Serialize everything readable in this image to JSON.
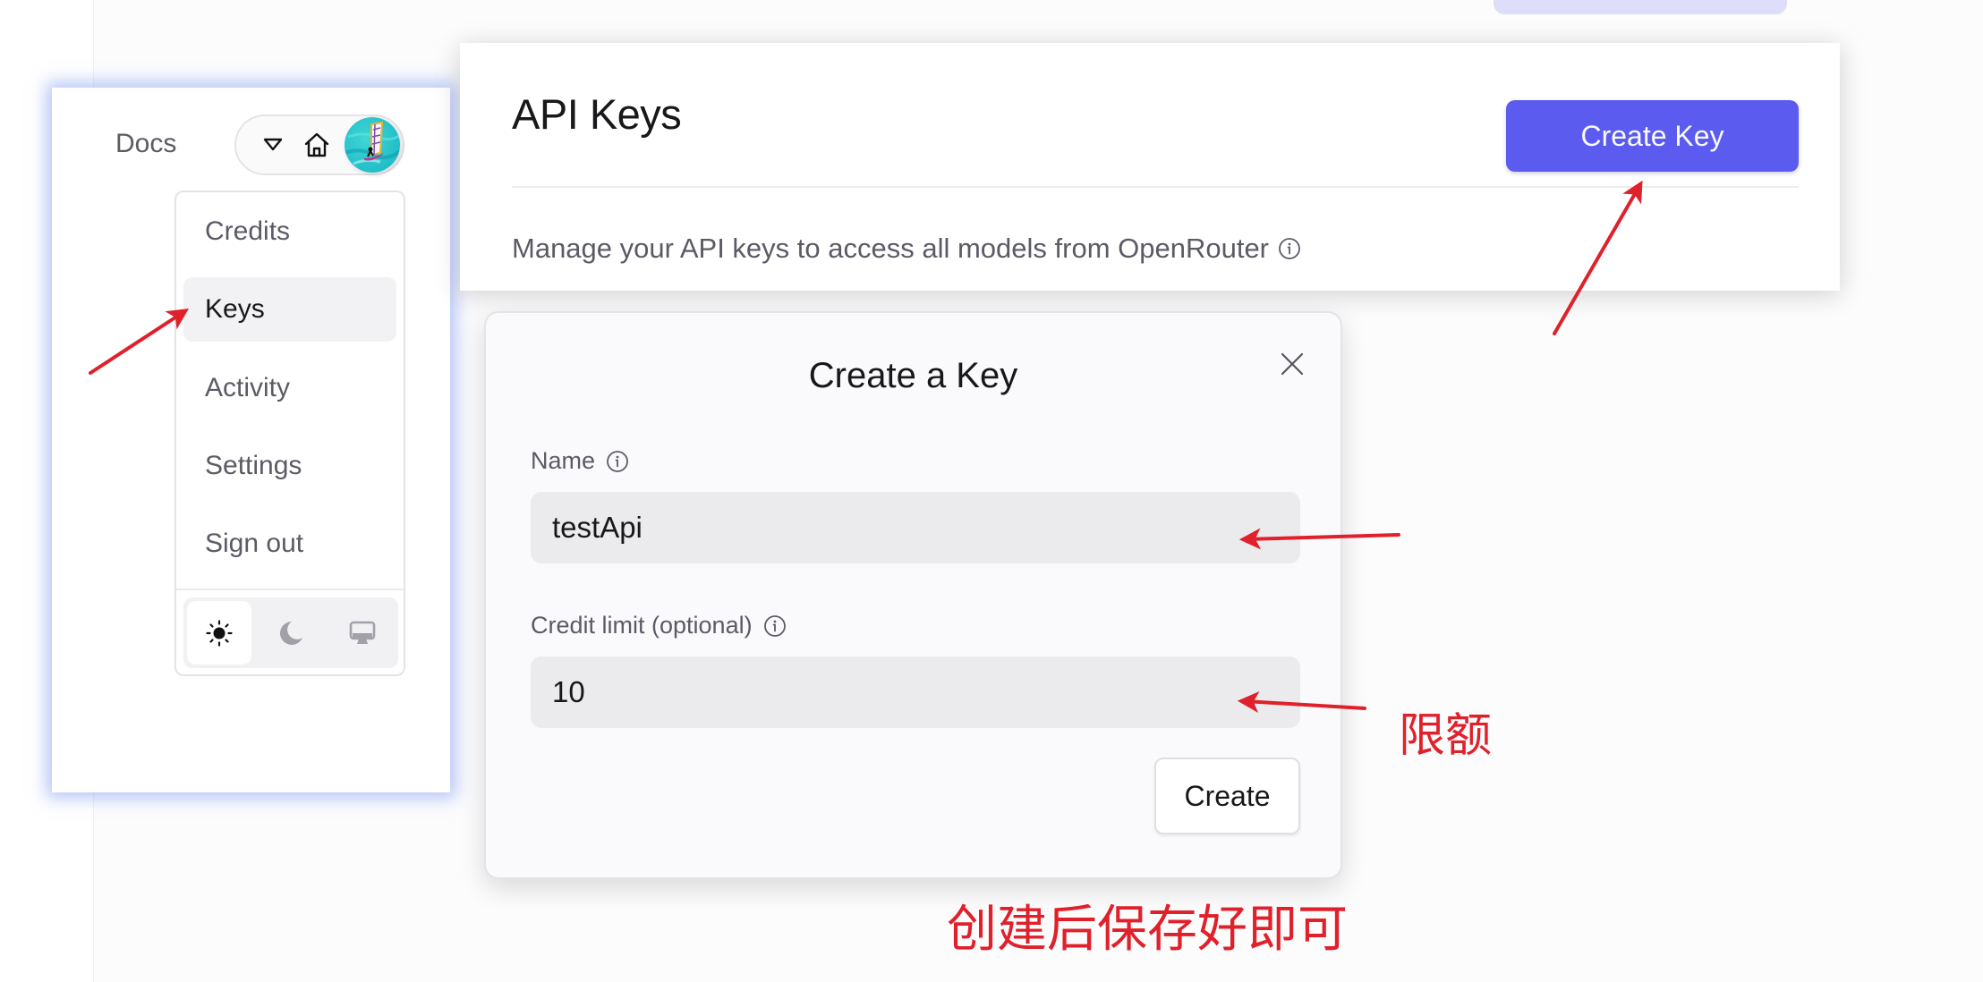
{
  "left_panel": {
    "docs_link": "Docs",
    "nav_icons": [
      "caret-down-icon",
      "home-icon",
      "avatar"
    ],
    "menu_items": [
      {
        "label": "Credits",
        "active": false
      },
      {
        "label": "Keys",
        "active": true
      },
      {
        "label": "Activity",
        "active": false
      },
      {
        "label": "Settings",
        "active": false
      },
      {
        "label": "Sign out",
        "active": false
      }
    ],
    "theme_options": [
      {
        "icon": "sun-icon",
        "name": "light",
        "active": true
      },
      {
        "icon": "moon-icon",
        "name": "dark",
        "active": false
      },
      {
        "icon": "monitor-icon",
        "name": "system",
        "active": false
      }
    ]
  },
  "api_keys": {
    "title": "API Keys",
    "create_key_label": "Create Key",
    "description": "Manage your API keys to access all models from OpenRouter",
    "accent_color": "#5b5bef"
  },
  "modal": {
    "title": "Create a Key",
    "name_label": "Name",
    "name_value": "testApi",
    "credit_label": "Credit limit (optional)",
    "credit_value": "10",
    "create_label": "Create"
  },
  "annotations": {
    "limit_note": "限额",
    "save_note": "创建后保存好即可",
    "color": "#e0202a"
  }
}
